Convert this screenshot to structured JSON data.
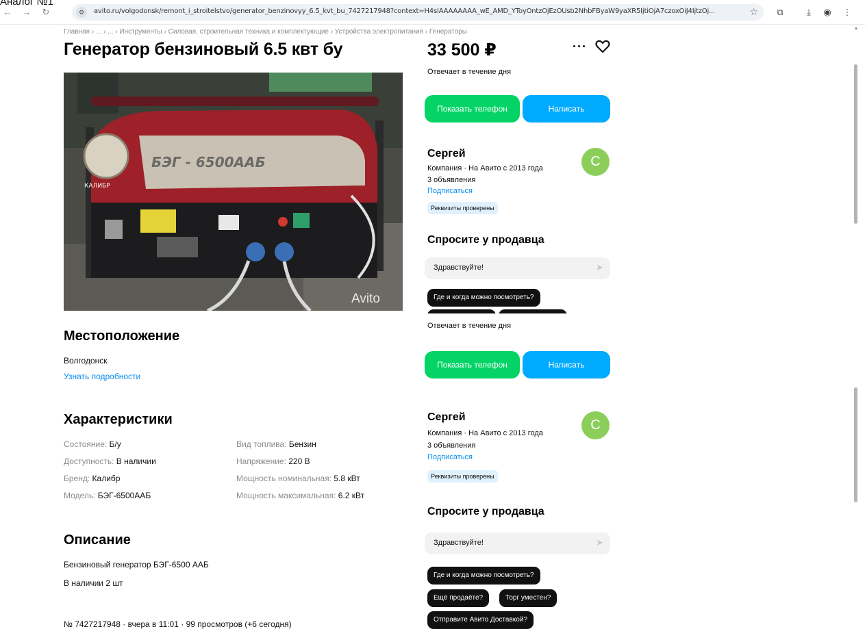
{
  "overlay": {
    "label": "Аналог №1"
  },
  "browser": {
    "url": "avito.ru/volgodonsk/remont_i_stroitelstvo/generator_benzinovyy_6.5_kvt_bu_7427217948?context=H4sIAAAAAAAA_wE_AMD_YToyOntzOjEzOUsb2NhbFByaW9yaXR5IjtiOjA7czoxOiJ4IjtzOj...",
    "icons": [
      "back-icon",
      "forward-icon",
      "reload-icon",
      "site-settings-icon",
      "bookmark-star-icon",
      "extensions-icon",
      "downloads-icon",
      "profile-icon",
      "menu-icon"
    ]
  },
  "breadcrumb": "Главная › ... › ... › Инструменты › Силовая, строительная техника и комплектующие › Устройства электропитания › Генераторы",
  "listing": {
    "title": "Генератор бензиновый 6.5 квт бу",
    "photo_text": "БЭГ - 6500ААБ",
    "photo_brand": "КАЛИБР",
    "photo_watermark": "Avito"
  },
  "location": {
    "heading": "Местоположение",
    "city": "Волгодонск",
    "details_link": "Узнать подробности"
  },
  "specs": {
    "heading": "Характеристики",
    "left": [
      {
        "key": "Состояние: ",
        "value": "Б/у"
      },
      {
        "key": "Доступность: ",
        "value": "В наличии"
      },
      {
        "key": "Бренд: ",
        "value": "Калибр"
      },
      {
        "key": "Модель: ",
        "value": "БЭГ-6500ААБ"
      }
    ],
    "right": [
      {
        "key": "Вид топлива: ",
        "value": "Бензин"
      },
      {
        "key": "Напряжение: ",
        "value": "220 В"
      },
      {
        "key": "Мощность номинальная: ",
        "value": "5.8 кВт"
      },
      {
        "key": "Мощность максимальная: ",
        "value": "6.2 кВт"
      }
    ]
  },
  "description": {
    "heading": "Описание",
    "lines": [
      "Бензиновый генератор БЭГ-6500 ААБ",
      "В наличии 2 шт"
    ]
  },
  "footer_meta": "№ 7427217948 · вчера в 11:01 · 99 просмотров (+6 сегодня)",
  "sidebar": {
    "price": "33 500 ₽",
    "more_label": "···",
    "response_time": "Отвечает в течение дня",
    "show_phone": "Показать телефон",
    "write": "Написать",
    "seller": {
      "name": "Сергей",
      "avatar_letter": "С",
      "info": "Компания · На Авито с 2013 года",
      "ads": "3 объявления",
      "subscribe": "Подписаться",
      "badge": "Реквизиты проверены"
    },
    "ask": {
      "title": "Спросите у продавца",
      "input_value": "Здравствуйте!",
      "chips": [
        "Где и когда можно посмотреть?",
        "Ещё продаёте?",
        "Торг уместен?",
        "Отправите Авито Доставкой?"
      ]
    }
  },
  "colors": {
    "green": "#04d466",
    "blue": "#00aaff",
    "link": "#0a8ef0",
    "badge_bg": "#dff1fd",
    "avatar": "#8bcf5a"
  }
}
